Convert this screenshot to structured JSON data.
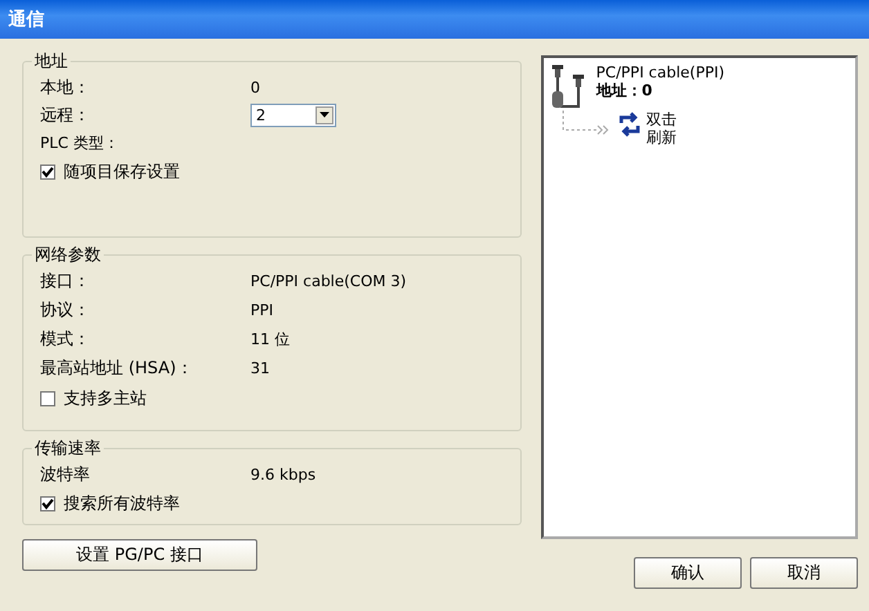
{
  "window": {
    "title": "通信"
  },
  "address_group": {
    "title": "地址",
    "local_label": "本地：",
    "local_value": "0",
    "remote_label": "远程：",
    "remote_value": "2",
    "plc_type_label": "PLC 类型：",
    "save_with_project": {
      "label": "随项目保存设置",
      "checked": true
    }
  },
  "network_group": {
    "title": "网络参数",
    "rows": [
      {
        "label": "接口：",
        "value": "PC/PPI cable(COM 3)"
      },
      {
        "label": "协议：",
        "value": "PPI"
      },
      {
        "label": "模式：",
        "value": "11 位"
      },
      {
        "label": "最高站地址 (HSA)：",
        "value": "31"
      }
    ],
    "multi_master": {
      "label": "支持多主站",
      "checked": false
    }
  },
  "baud_group": {
    "title": "传输速率",
    "label": "波特率",
    "value": "9.6 kbps",
    "search_all": {
      "label": "搜索所有波特率",
      "checked": true
    }
  },
  "device_tree": {
    "cable_name": "PC/PPI cable(PPI)",
    "cable_address": "地址：0",
    "refresh_line1": "双击",
    "refresh_line2": "刷新"
  },
  "buttons": {
    "set_interface": "设置 PG/PC 接口",
    "ok": "确认",
    "cancel": "取消"
  }
}
